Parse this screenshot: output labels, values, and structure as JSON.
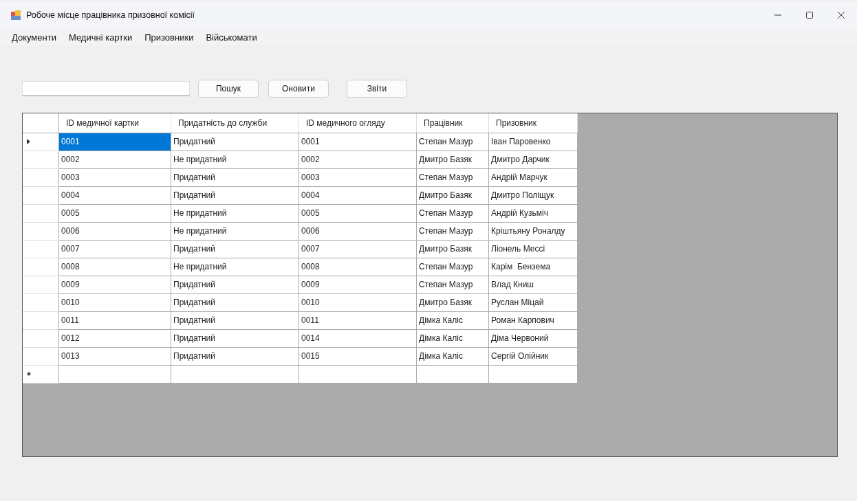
{
  "window": {
    "title": "Робоче місце працівника призовної комісії"
  },
  "menu": [
    "Документи",
    "Медичні картки",
    "Призовники",
    "Військомати"
  ],
  "buttons": [
    "Пошук",
    "Оновити",
    "Звіти"
  ],
  "table": {
    "columns": [
      "ID медичної картки",
      "Придатність до служби",
      "ID медичного огляду",
      "Працівник",
      "Призовник"
    ],
    "rows": [
      {
        "selected": true,
        "cells": [
          "0001",
          "Придатний",
          "0001",
          "Степан Мазур",
          "Іван Паровенко"
        ]
      },
      {
        "selected": false,
        "cells": [
          "0002",
          "Не придатний",
          "0002",
          "Дмитро Базяк",
          "Дмитро Дарчик"
        ]
      },
      {
        "selected": false,
        "cells": [
          "0003",
          "Придатний",
          "0003",
          "Степан Мазур",
          "Андрій Марчук"
        ]
      },
      {
        "selected": false,
        "cells": [
          "0004",
          "Придатний",
          "0004",
          "Дмитро Базяк",
          "Дмитро Поліщук"
        ]
      },
      {
        "selected": false,
        "cells": [
          "0005",
          "Не придатний",
          "0005",
          "Степан Мазур",
          "Андрій Кузьміч"
        ]
      },
      {
        "selected": false,
        "cells": [
          "0006",
          "Не придатний",
          "0006",
          "Степан Мазур",
          "Кріштьяну Роналду"
        ]
      },
      {
        "selected": false,
        "cells": [
          "0007",
          "Придатний",
          "0007",
          "Дмитро Базяк",
          "Ліонель Мессі"
        ]
      },
      {
        "selected": false,
        "cells": [
          "0008",
          "Не придатний",
          "0008",
          "Степан Мазур",
          "Карім  Бензема"
        ]
      },
      {
        "selected": false,
        "cells": [
          "0009",
          "Придатний",
          "0009",
          "Степан Мазур",
          "Влад Книш"
        ]
      },
      {
        "selected": false,
        "cells": [
          "0010",
          "Придатний",
          "0010",
          "Дмитро Базяк",
          "Руслан Міцай"
        ]
      },
      {
        "selected": false,
        "cells": [
          "0011",
          "Придатний",
          "0011",
          "Дімка Каліс",
          "Роман Карпович"
        ]
      },
      {
        "selected": false,
        "cells": [
          "0012",
          "Придатний",
          "0014",
          "Дімка Каліс",
          "Діма Червоний"
        ]
      },
      {
        "selected": false,
        "cells": [
          "0013",
          "Придатний",
          "0015",
          "Дімка Каліс",
          "Сергій Олійник"
        ]
      }
    ]
  }
}
